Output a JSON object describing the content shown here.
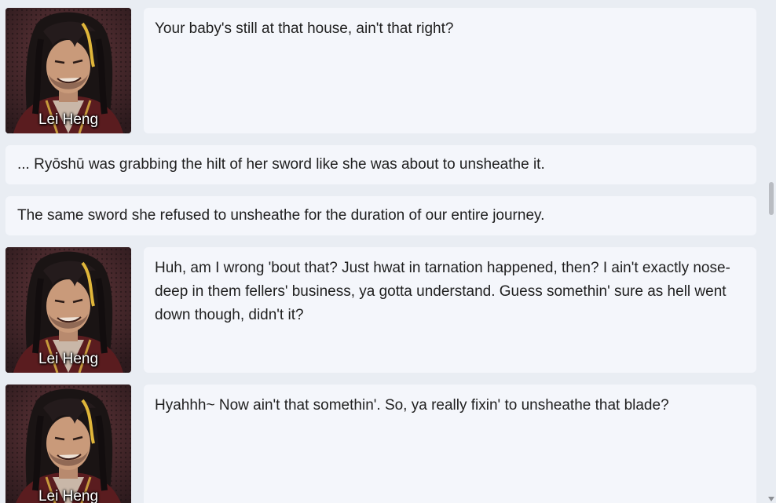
{
  "messages": [
    {
      "type": "dialogue",
      "speaker": "Lei Heng",
      "text": "Your baby's still at that house, ain't that right?"
    },
    {
      "type": "narration",
      "text": "... Ryōshū was grabbing the hilt of her sword like she was about to unsheathe it."
    },
    {
      "type": "narration",
      "text": "The same sword she refused to unsheathe for the duration of our entire journey."
    },
    {
      "type": "dialogue",
      "speaker": "Lei Heng",
      "text": "Huh, am I wrong 'bout that? Just hwat in tarnation happened, then? I ain't exactly nose-deep in them fellers' business, ya gotta understand. Guess somethin' sure as hell went down though, didn't it?"
    },
    {
      "type": "dialogue",
      "speaker": "Lei Heng",
      "text": "Hyahhh~ Now ain't that somethin'. So, ya really fixin' to unsheathe that blade?"
    }
  ],
  "colors": {
    "background": "#e9edf3",
    "bubble": "#f4f6fb",
    "text": "#1f1f1f"
  },
  "icons": {
    "scroll_down": "chevron-down-icon"
  }
}
